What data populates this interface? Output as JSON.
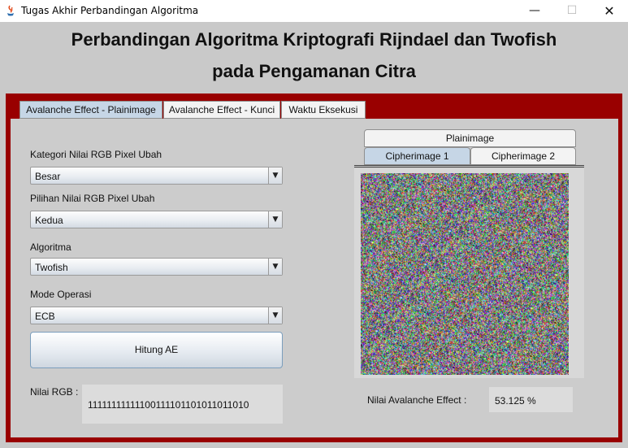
{
  "window": {
    "title": "Tugas Akhir Perbandingan Algoritma",
    "minimize_glyph": "—",
    "maximize_glyph": "☐",
    "close_glyph": "✕"
  },
  "header": {
    "line1": "Perbandingan Algoritma Kriptografi Rijndael dan Twofish",
    "line2": "pada Pengamanan Citra"
  },
  "tabs": [
    {
      "label": "Avalanche Effect - Plainimage",
      "active": true
    },
    {
      "label": "Avalanche Effect - Kunci",
      "active": false
    },
    {
      "label": "Waktu Eksekusi",
      "active": false
    }
  ],
  "form": {
    "kategori": {
      "label": "Kategori Nilai RGB Pixel Ubah",
      "value": "Besar"
    },
    "pilihan": {
      "label": "Pilihan Nilai RGB Pixel Ubah",
      "value": "Kedua"
    },
    "algoritma": {
      "label": "Algoritma",
      "value": "Twofish"
    },
    "mode": {
      "label": "Mode Operasi",
      "value": "ECB"
    },
    "hitung_button": "Hitung AE",
    "rgb": {
      "label": "Nilai RGB :",
      "value": "111111111111001111011010110110​10"
    }
  },
  "image_panel": {
    "tabs": [
      {
        "label": "Plainimage",
        "active": false
      },
      {
        "label": "Cipherimage 1",
        "active": true
      },
      {
        "label": "Cipherimage 2",
        "active": false
      }
    ]
  },
  "result": {
    "label": "Nilai Avalanche Effect :",
    "value": "53.125 %"
  },
  "colors": {
    "panel_red": "#990000",
    "active_tab": "#c6d6e6"
  }
}
